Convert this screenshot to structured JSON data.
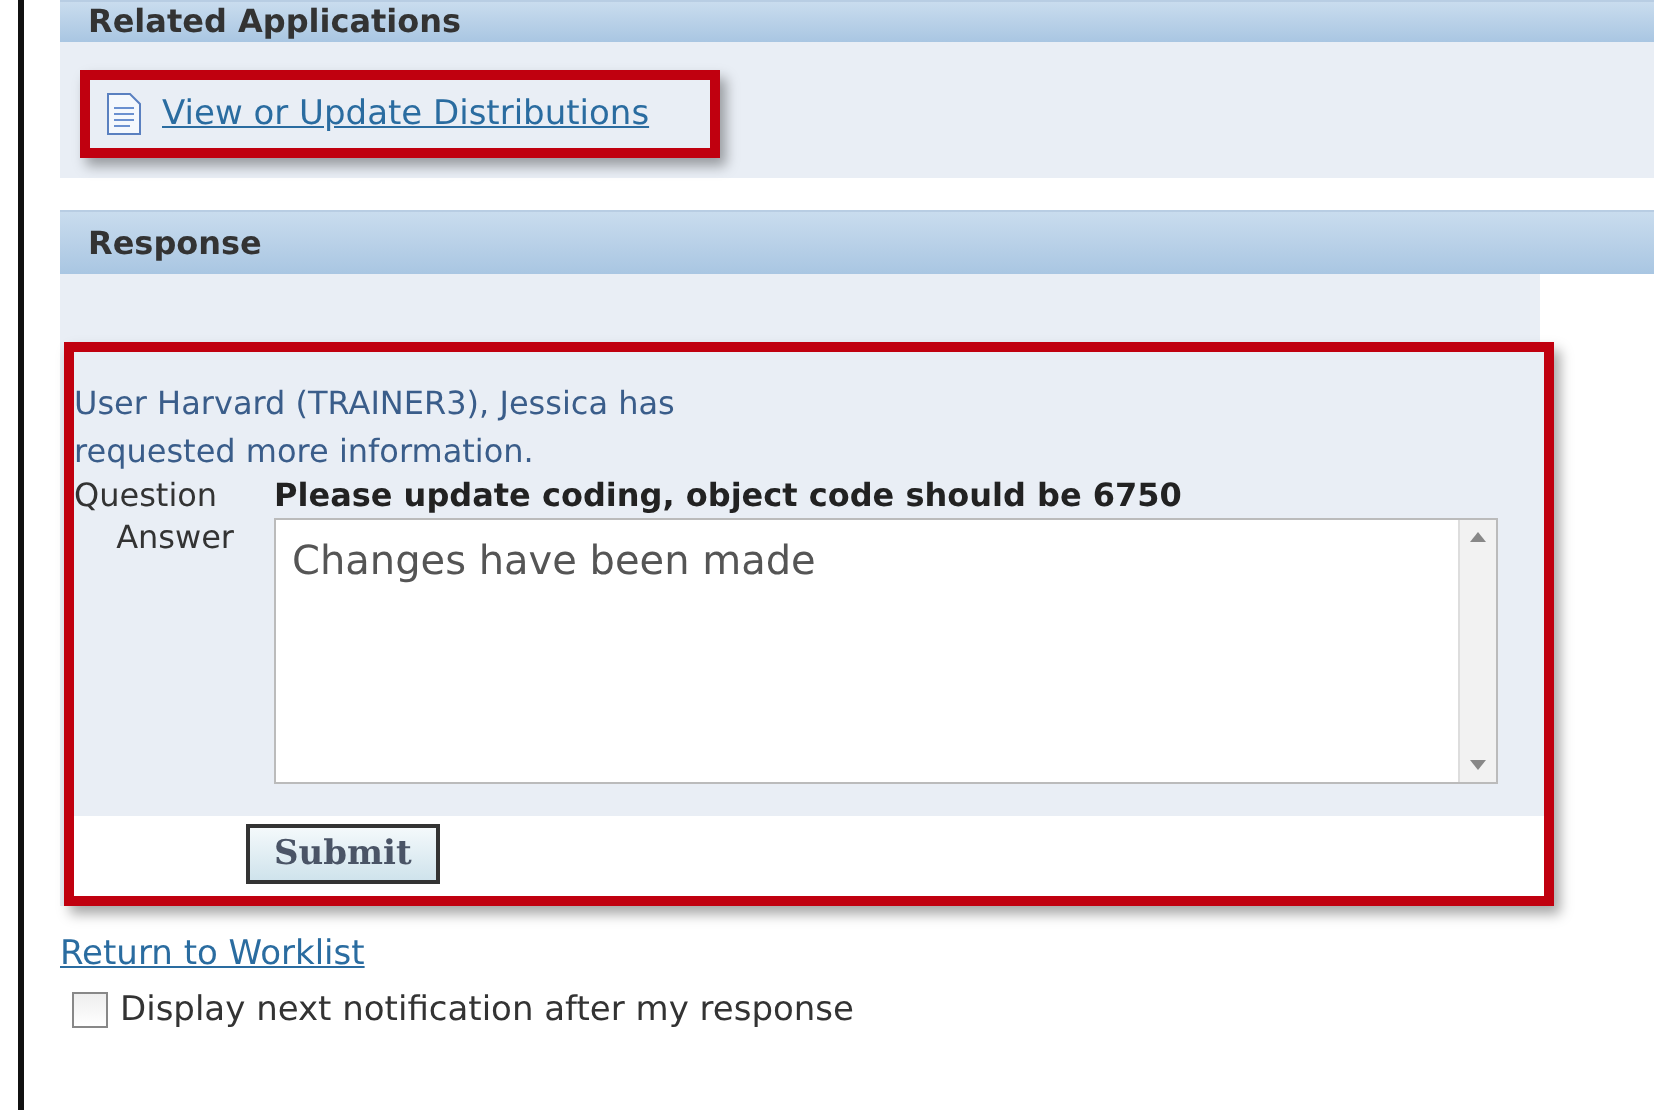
{
  "related_applications": {
    "title": "Related Applications",
    "links": [
      {
        "label": "View or Update Distributions",
        "highlighted": true
      }
    ]
  },
  "response": {
    "title": "Response",
    "highlighted": true,
    "message": "User Harvard (TRAINER3), Jessica has requested more information.",
    "question_label": "Question",
    "question": "Please update coding, object code should be 6750",
    "answer_label": "Answer",
    "answer": "Changes have been made",
    "submit": "Submit"
  },
  "return_link": "Return to Worklist",
  "next_notification": {
    "label": "Display next notification after my response",
    "checked": false
  }
}
